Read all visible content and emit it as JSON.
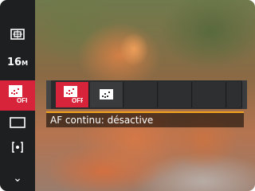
{
  "sidebar": {
    "items": [
      {
        "name": "metering-icon"
      },
      {
        "name": "resolution",
        "value": "16",
        "unit": "M"
      },
      {
        "name": "af-continuous-off-icon",
        "badge": "OFF",
        "selected": true
      },
      {
        "name": "aspect-ratio-icon"
      },
      {
        "name": "face-detect-icon"
      },
      {
        "name": "scroll-down-icon",
        "glyph": "⌄"
      }
    ]
  },
  "options": {
    "items": [
      {
        "name": "af-continuous-off-option",
        "badge": "OFF",
        "selected": true
      },
      {
        "name": "af-continuous-on-option",
        "selected": false
      }
    ],
    "description": "AF continu: désactive"
  },
  "colors": {
    "accent_red": "#d8243b",
    "highlight_orange": "#f0a21f",
    "sidebar_bg": "#1e1f21"
  }
}
